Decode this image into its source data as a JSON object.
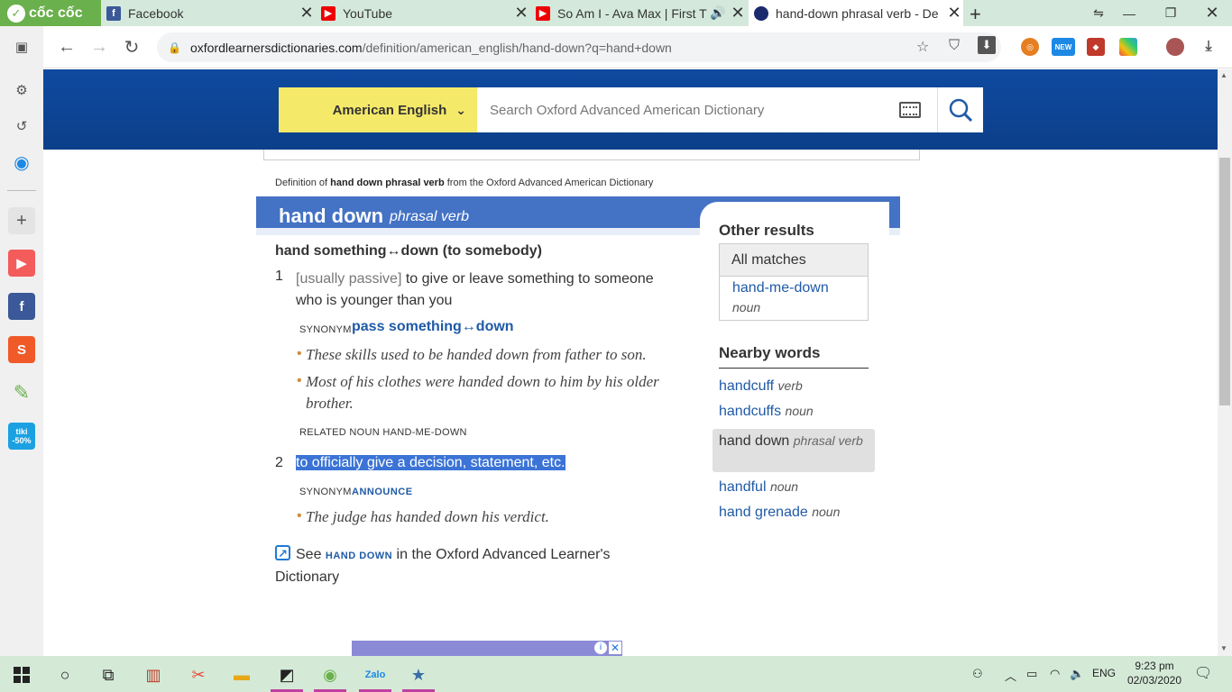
{
  "browser": {
    "brand": "cốc cốc",
    "tabs": [
      {
        "title": "Facebook",
        "icon": "facebook-icon"
      },
      {
        "title": "YouTube",
        "icon": "youtube-icon"
      },
      {
        "title": "So Am I - Ava Max | First T",
        "icon": "youtube-icon",
        "audio": true
      },
      {
        "title": "hand-down phrasal verb - De",
        "icon": "oxford-icon",
        "active": true
      }
    ],
    "url_host": "oxfordlearnersdictionaries.com",
    "url_path": "/definition/american_english/hand-down?q=hand+down",
    "ext_new_badge": "NEW"
  },
  "header": {
    "dictionary_select": "American English",
    "search_placeholder": "Search Oxford Advanced American Dictionary"
  },
  "entry": {
    "def_of_prefix": "Definition of ",
    "def_of_bold": "hand down phrasal verb",
    "def_of_suffix": " from the Oxford Advanced American Dictionary",
    "headword": "hand down",
    "pos": "phrasal verb",
    "phrase": "hand something↔down (to somebody)",
    "senses": [
      {
        "num": "1",
        "grammar": "[usually passive]",
        "def": " to give or leave something to someone who is younger than you",
        "syn_label": "SYNONYM",
        "syn": "pass something↔down",
        "examples": [
          "These skills used to be handed down from father to son.",
          "Most of his clothes were handed down to him by his older brother."
        ],
        "related_label": "RELATED NOUN",
        "related": "HAND-ME-DOWN"
      },
      {
        "num": "2",
        "def": "to officially give a decision, statement, etc.",
        "syn_label": "SYNONYM",
        "syn": "ANNOUNCE",
        "examples": [
          "The judge has handed down his verdict."
        ]
      }
    ],
    "see_prefix": "See ",
    "see_link": "HAND DOWN",
    "see_suffix": " in the Oxford Advanced Learner's Dictionary"
  },
  "sidebar_results": {
    "other_results_title": "Other results",
    "all_matches": "All matches",
    "match_word": "hand-me-down",
    "match_pos": "noun",
    "nearby_title": "Nearby words",
    "nearby": [
      {
        "word": "handcuff",
        "pos": "verb"
      },
      {
        "word": "handcuffs",
        "pos": "noun"
      },
      {
        "word": "hand down",
        "pos": "phrasal verb",
        "current": true
      },
      {
        "word": "handful",
        "pos": "noun"
      },
      {
        "word": "hand grenade",
        "pos": "noun"
      }
    ]
  },
  "taskbar": {
    "lang": "ENG",
    "time": "9:23 pm",
    "date": "02/03/2020"
  },
  "sidebar_apps": {
    "tiki_label": "tiki",
    "tiki_discount": "-50%"
  },
  "colors": {
    "oxford_blue": "#0f4aa0",
    "headword_bar": "#4472c4",
    "dict_select": "#f5e96a",
    "link": "#1f5aa6",
    "selection": "#3b73d6"
  }
}
